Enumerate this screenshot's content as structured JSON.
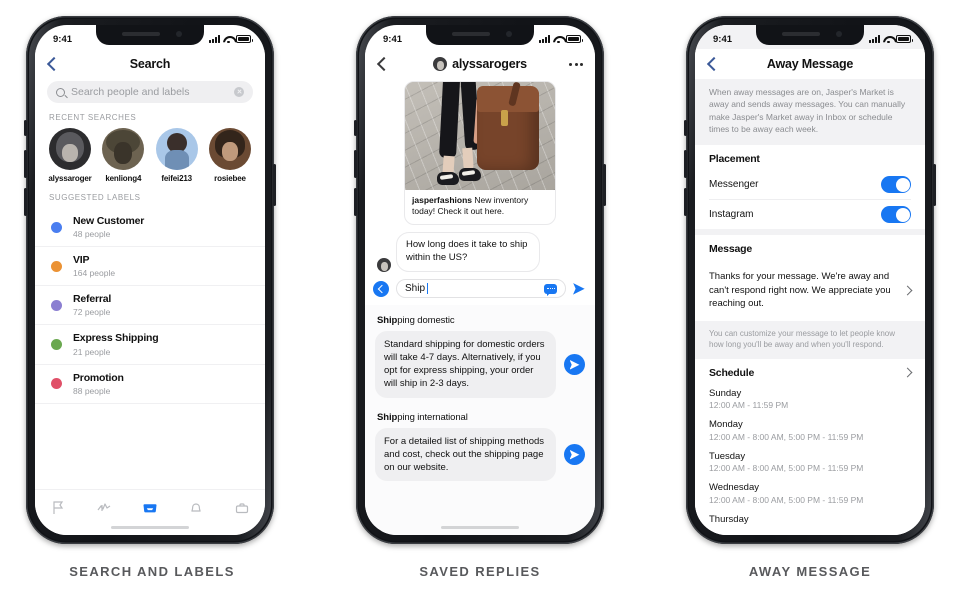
{
  "status_bar": {
    "time": "9:41",
    "signal_icon": "cellular-signal-icon",
    "wifi_icon": "wifi-icon",
    "battery_icon": "battery-icon"
  },
  "captions": {
    "phone1": "SEARCH AND LABELS",
    "phone2": "SAVED REPLIES",
    "phone3": "AWAY MESSAGE"
  },
  "phone1": {
    "nav": {
      "title": "Search",
      "back_icon": "chevron-left-icon"
    },
    "search": {
      "placeholder": "Search people and labels",
      "value": "",
      "search_icon": "search-icon",
      "clear_icon": "clear-circle-icon"
    },
    "recent_header": "RECENT SEARCHES",
    "recents": [
      {
        "name": "alyssaroger"
      },
      {
        "name": "kenliong4"
      },
      {
        "name": "feifei213"
      },
      {
        "name": "rosiebee"
      }
    ],
    "labels_header": "SUGGESTED LABELS",
    "labels": [
      {
        "name": "New Customer",
        "count": "48 people",
        "color": "#4a7ef0"
      },
      {
        "name": "VIP",
        "count": "164 people",
        "color": "#eb9234"
      },
      {
        "name": "Referral",
        "count": "72 people",
        "color": "#8b7fd1"
      },
      {
        "name": "Express Shipping",
        "count": "21 people",
        "color": "#6aa84f"
      },
      {
        "name": "Promotion",
        "count": "88 people",
        "color": "#e05068"
      }
    ],
    "tabs": [
      {
        "icon": "flag-icon",
        "active": false
      },
      {
        "icon": "analytics-icon",
        "active": false
      },
      {
        "icon": "inbox-icon",
        "active": true
      },
      {
        "icon": "bell-icon",
        "active": false
      },
      {
        "icon": "briefcase-icon",
        "active": false
      }
    ],
    "accent": "#1877f2"
  },
  "phone2": {
    "nav": {
      "title": "alyssarogers",
      "back_icon": "chevron-left-icon",
      "more_icon": "more-options-icon",
      "avatar": "contact-avatar"
    },
    "post": {
      "caption_author": "jasperfashions",
      "caption_text": " New inventory today! Check it out here.",
      "image_alt": "handbag-photo"
    },
    "incoming_message": "How long does it take to ship within the US?",
    "input": {
      "value": "Ship",
      "back_icon": "back-circle-icon",
      "saved_replies_icon": "saved-replies-bubble-icon",
      "send_icon": "send-icon"
    },
    "suggestions": [
      {
        "title_bold": "Ship",
        "title_rest": "ping domestic",
        "body": "Standard shipping for domestic orders will take 4-7 days. Alternatively, if you opt for express shipping, your order will ship in 2-3 days.",
        "send_icon": "send-circle-icon"
      },
      {
        "title_bold": "Ship",
        "title_rest": "ping international",
        "body": "For a detailed list of shipping methods and cost, check out the shipping page on our website.",
        "send_icon": "send-circle-icon"
      }
    ]
  },
  "phone3": {
    "nav": {
      "title": "Away Message",
      "back_icon": "chevron-left-icon"
    },
    "description": "When away messages are on, Jasper's Market is away and sends away messages. You can manually make Jasper's Market away in Inbox or schedule times to be away each week.",
    "placement": {
      "header": "Placement",
      "rows": [
        {
          "label": "Messenger",
          "on": true
        },
        {
          "label": "Instagram",
          "on": true
        }
      ]
    },
    "message": {
      "header": "Message",
      "text": "Thanks for your message. We're away and can't respond right now. We appreciate you reaching out.",
      "chevron_icon": "chevron-right-icon"
    },
    "note": "You can customize your message to let people know how long you'll be away and when you'll respond.",
    "schedule": {
      "header": "Schedule",
      "chevron_icon": "chevron-right-icon",
      "days": [
        {
          "name": "Sunday",
          "times": "12:00 AM - 11:59 PM"
        },
        {
          "name": "Monday",
          "times": "12:00 AM - 8:00 AM, 5:00 PM - 11:59 PM"
        },
        {
          "name": "Tuesday",
          "times": "12:00 AM - 8:00 AM, 5:00 PM - 11:59 PM"
        },
        {
          "name": "Wednesday",
          "times": "12:00 AM - 8:00 AM, 5:00 PM - 11:59 PM"
        },
        {
          "name": "Thursday",
          "times": ""
        }
      ]
    }
  }
}
